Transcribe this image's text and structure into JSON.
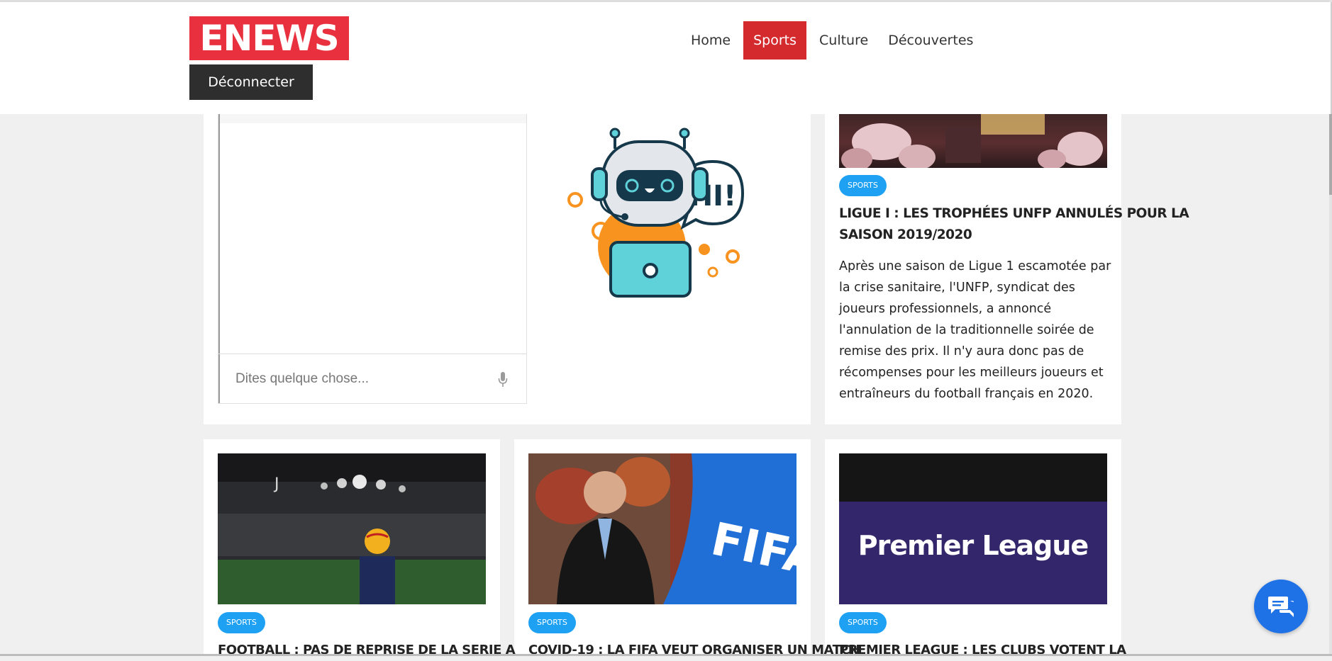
{
  "header": {
    "logo": "ENEWS",
    "logout_label": "Déconnecter",
    "nav": [
      {
        "label": "Home",
        "active": false
      },
      {
        "label": "Sports",
        "active": true
      },
      {
        "label": "Culture",
        "active": false
      },
      {
        "label": "Découvertes",
        "active": false
      }
    ]
  },
  "chatbot": {
    "placeholder": "Dites quelque chose...",
    "greeting": "HI!"
  },
  "featured": {
    "category": "SPORTS",
    "title_line1": "LIGUE I : LES TROPHÉES UNFP ANNULÉS POUR LA",
    "title_line2": "SAISON 2019/2020",
    "text": [
      "Après une saison de Ligue 1 escamotée par",
      "la crise sanitaire, l'UNFP, syndicat des",
      "joueurs professionnels, a annoncé",
      "l'annulation de la traditionnelle soirée de",
      "remise des prix. Il n'y aura donc pas de",
      "récompenses pour les meilleurs joueurs et",
      "entraîneurs du football français en 2020."
    ]
  },
  "articles": [
    {
      "category": "SPORTS",
      "title": "FOOTBALL : PAS DE REPRISE DE LA SERIE A"
    },
    {
      "category": "SPORTS",
      "title": "COVID-19 : LA FIFA VEUT ORGANISER UN MATCH"
    },
    {
      "category": "SPORTS",
      "title": "PREMIER LEAGUE : LES CLUBS VOTENT LA",
      "image_text": "Premier League"
    }
  ],
  "colors": {
    "brand": "#e8303f",
    "nav_active": "#d42a2e",
    "badge": "#1ea1f2",
    "fab": "#1e72e6"
  }
}
